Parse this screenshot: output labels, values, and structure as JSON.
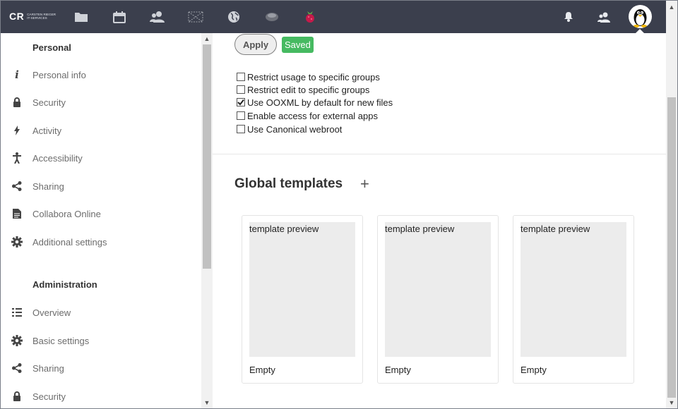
{
  "header": {
    "logo_text": "CR",
    "logo_sub_line1": "Carsten Rieger",
    "logo_sub_line2": "IT-Services",
    "apps": [
      "files-icon",
      "calendar-icon",
      "contacts-icon",
      "activity-icon",
      "globe-icon",
      "notes-icon",
      "raspberry-icon"
    ],
    "right_icons": [
      "notifications-icon",
      "contacts-menu-icon"
    ],
    "avatar": "tux-penguin-avatar"
  },
  "sidebar": {
    "personal_title": "Personal",
    "personal_items": [
      {
        "label": "Personal info",
        "icon": "info-icon"
      },
      {
        "label": "Security",
        "icon": "lock-icon"
      },
      {
        "label": "Activity",
        "icon": "lightning-icon"
      },
      {
        "label": "Accessibility",
        "icon": "accessibility-icon"
      },
      {
        "label": "Sharing",
        "icon": "share-icon"
      },
      {
        "label": "Collabora Online",
        "icon": "document-icon"
      },
      {
        "label": "Additional settings",
        "icon": "gear-icon"
      }
    ],
    "admin_title": "Administration",
    "admin_items": [
      {
        "label": "Overview",
        "icon": "list-icon"
      },
      {
        "label": "Basic settings",
        "icon": "gear-icon"
      },
      {
        "label": "Sharing",
        "icon": "share-icon"
      },
      {
        "label": "Security",
        "icon": "lock-icon"
      }
    ]
  },
  "main": {
    "apply_label": "Apply",
    "saved_label": "Saved",
    "options": [
      {
        "label": "Restrict usage to specific groups",
        "checked": false
      },
      {
        "label": "Restrict edit to specific groups",
        "checked": false
      },
      {
        "label": "Use OOXML by default for new files",
        "checked": true
      },
      {
        "label": "Enable access for external apps",
        "checked": false
      },
      {
        "label": "Use Canonical webroot",
        "checked": false
      }
    ],
    "templates_heading": "Global templates",
    "add_label": "+",
    "templates": [
      {
        "preview": "template preview",
        "name": "Empty"
      },
      {
        "preview": "template preview",
        "name": "Empty"
      },
      {
        "preview": "template preview",
        "name": "Empty"
      }
    ]
  },
  "colors": {
    "header_bg": "#3b3f4d",
    "saved_green": "#46ba61"
  }
}
